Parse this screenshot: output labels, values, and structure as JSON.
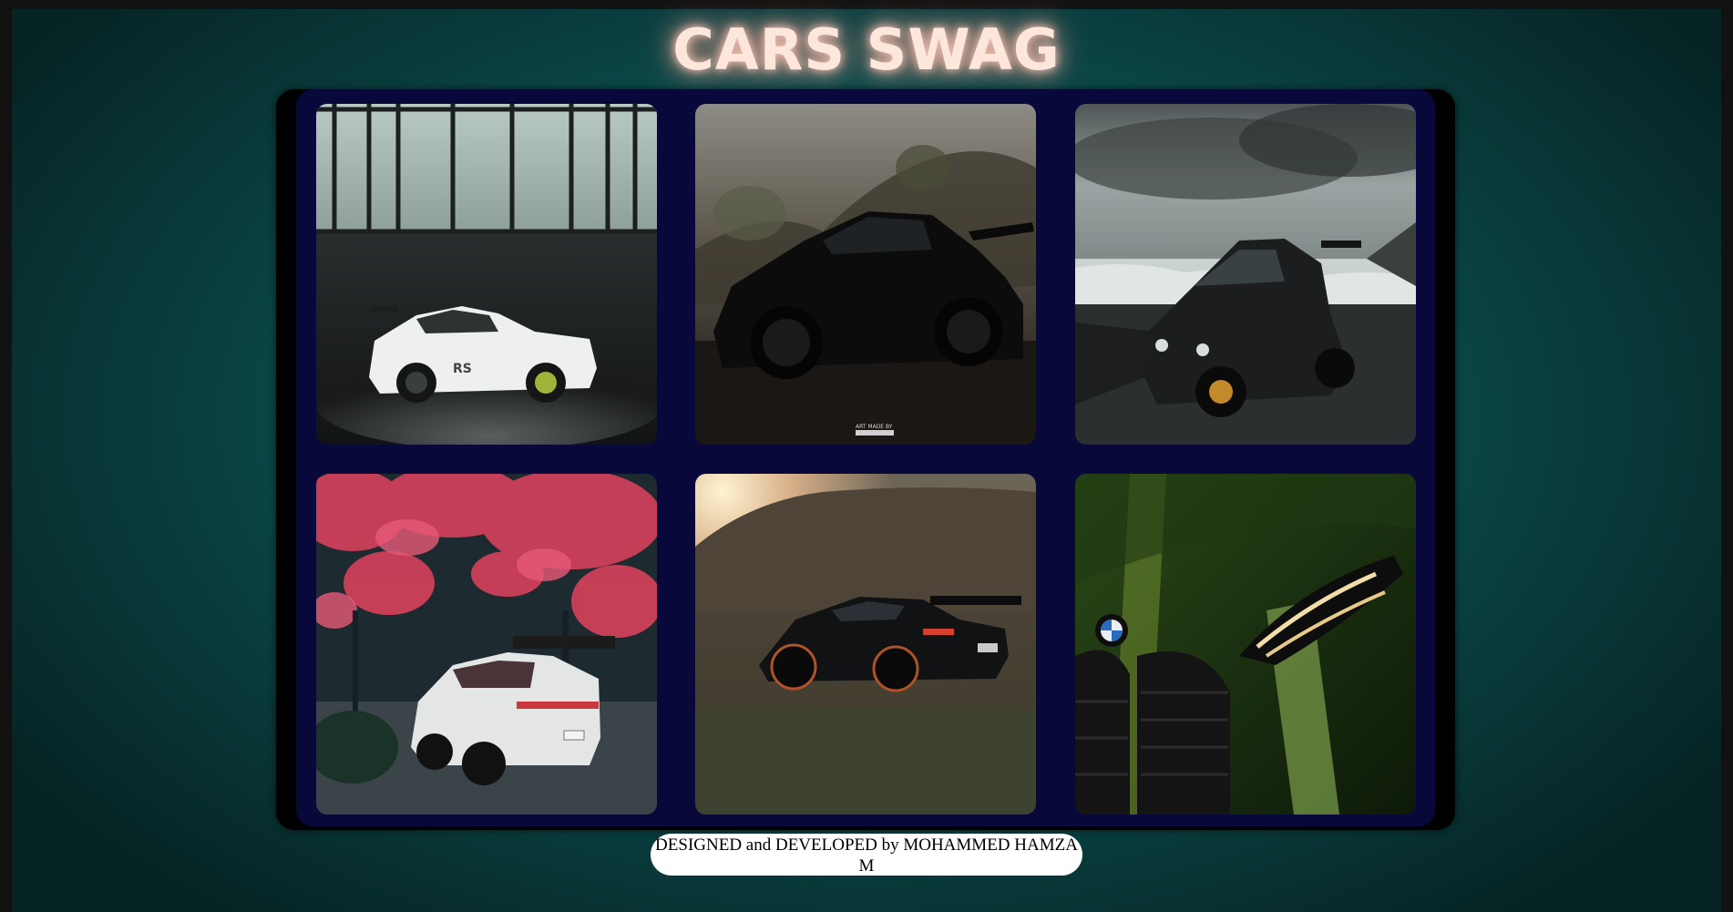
{
  "header": {
    "title": "CARS SWAG"
  },
  "gallery": {
    "images": [
      {
        "subject": "white-sports-car-hangar",
        "watermark": ""
      },
      {
        "subject": "black-sports-car-road",
        "watermark": "ART MADE BY"
      },
      {
        "subject": "black-sports-car-beach",
        "watermark": ""
      },
      {
        "subject": "white-sports-car-cherry-blossoms",
        "watermark": ""
      },
      {
        "subject": "black-sports-car-field-sunset",
        "watermark": ""
      },
      {
        "subject": "green-bmw-front-grille",
        "watermark": ""
      }
    ]
  },
  "footer": {
    "credit": "DESIGNED and DEVELOPED by MOHAMMED HAMZA M"
  },
  "colors": {
    "background": "#0b5858",
    "panel": "#08083a",
    "title": "#fde6dc",
    "title_glow": "#e7a898"
  }
}
